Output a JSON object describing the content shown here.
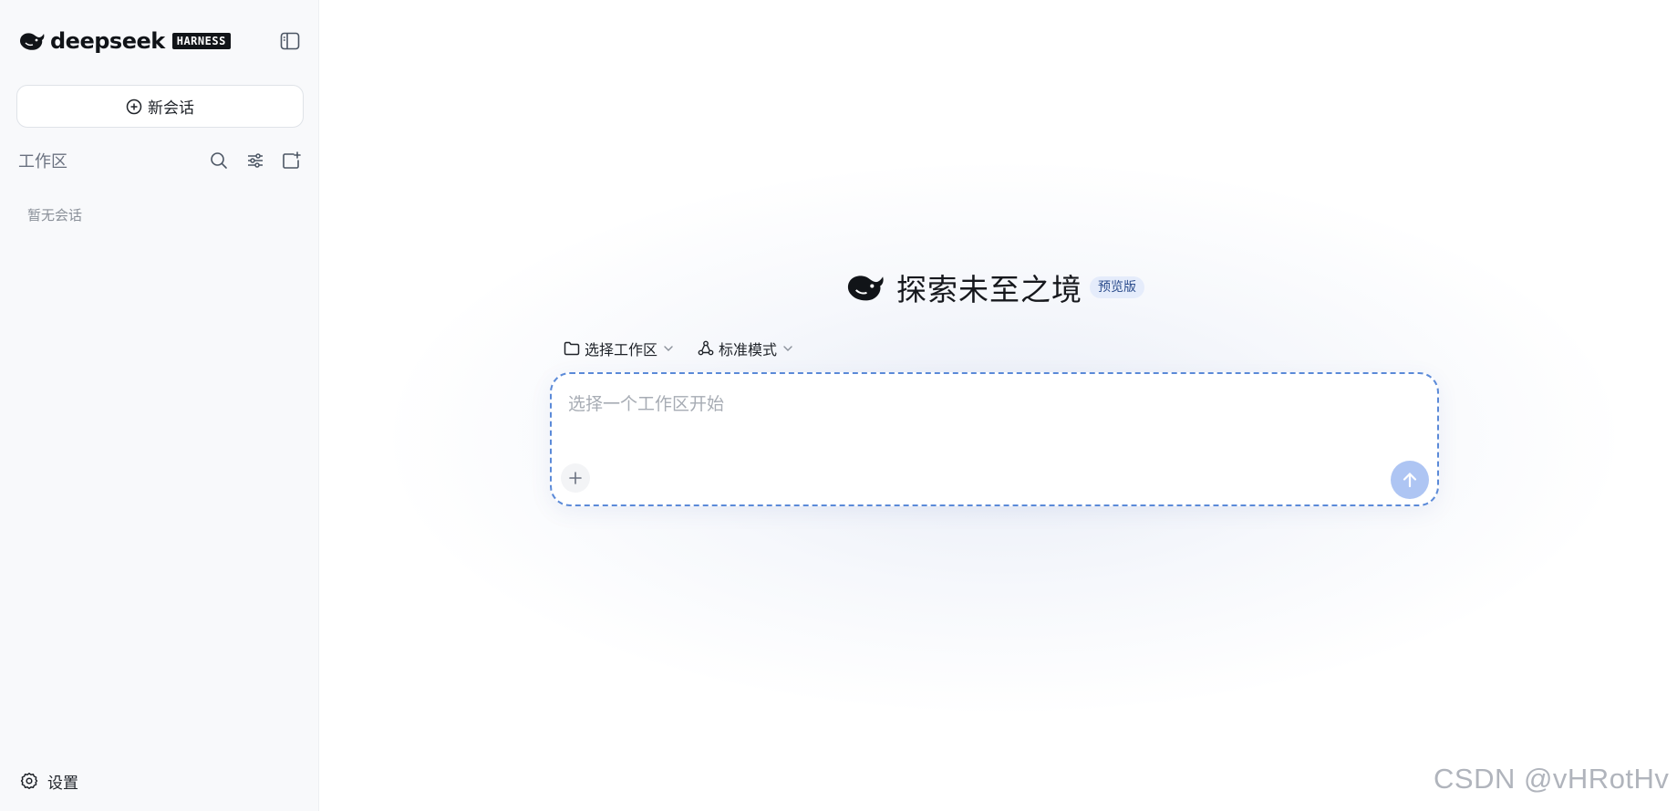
{
  "app": {
    "brand_name": "deepseek",
    "brand_badge": "HARNESS"
  },
  "sidebar": {
    "new_chat_label": "新会话",
    "workspace_title": "工作区",
    "empty_state": "暂无会话",
    "settings_label": "设置",
    "tool_icons": [
      "search-icon",
      "filter-sliders-icon",
      "add-folder-icon"
    ]
  },
  "main": {
    "hero_title": "探索未至之境",
    "preview_badge": "预览版",
    "workspace_select_label": "选择工作区",
    "mode_select_label": "标准模式",
    "input_placeholder": "选择一个工作区开始"
  },
  "watermark": "CSDN @vHRotHv",
  "colors": {
    "sidebar_bg": "#f8f9fb",
    "accent": "#5b8ad8",
    "send_button": "#aec5f3",
    "badge_bg": "#e5ecfb",
    "badge_text": "#2b4c8c"
  }
}
